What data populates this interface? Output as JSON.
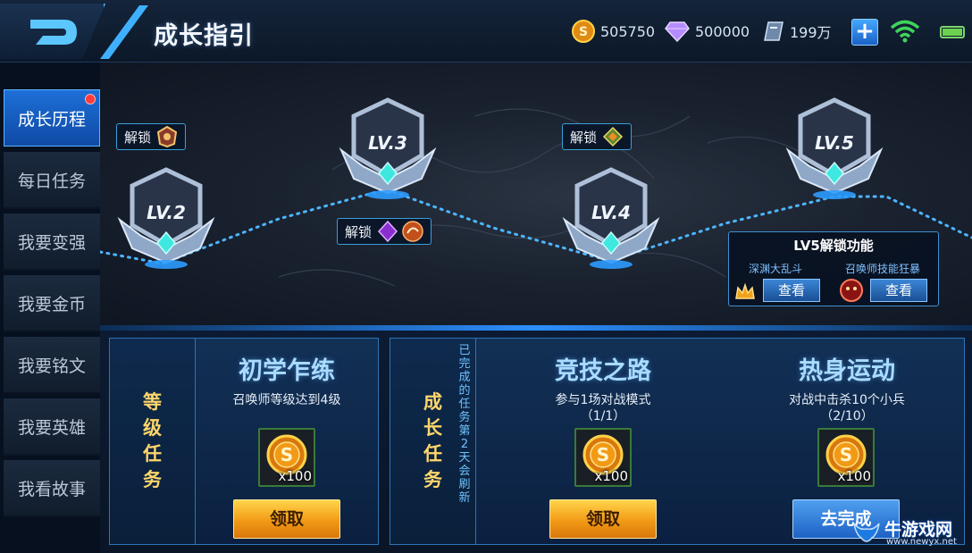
{
  "header": {
    "title": "成长指引",
    "gold": "505750",
    "gems": "500000",
    "vouchers": "199万",
    "plus_label": "+"
  },
  "sidebar": {
    "items": [
      {
        "label": "成长历程",
        "active": true
      },
      {
        "label": "每日任务"
      },
      {
        "label": "我要变强"
      },
      {
        "label": "我要金币"
      },
      {
        "label": "我要铭文"
      },
      {
        "label": "我要英雄"
      },
      {
        "label": "我看故事"
      }
    ]
  },
  "map": {
    "levels": [
      "LV.2",
      "LV.3",
      "LV.4",
      "LV.5"
    ],
    "unlock_label": "解锁",
    "lv5_panel": {
      "title": "LV5解锁功能",
      "feature_1": "深渊大乱斗",
      "feature_2": "召唤师技能狂暴",
      "view_label": "查看"
    }
  },
  "level_tasks": {
    "label_chars": [
      "等",
      "级",
      "任",
      "务"
    ],
    "task": {
      "name": "初学乍练",
      "desc": "召唤师等级达到4级",
      "reward_qty": "x100",
      "button": "领取"
    }
  },
  "growth_tasks": {
    "label_chars": [
      "成",
      "长",
      "任",
      "务"
    ],
    "note_chars": [
      "已",
      "完",
      "成",
      "的",
      "任",
      "务",
      "第",
      "2",
      "天",
      "会",
      "刷",
      "新"
    ],
    "tasks": [
      {
        "name": "竞技之路",
        "desc": "参与1场对战模式",
        "progress": "（1/1）",
        "reward_qty": "x100",
        "button": "领取"
      },
      {
        "name": "热身运动",
        "desc": "对战中击杀10个小兵",
        "progress": "（2/10）",
        "reward_qty": "x100",
        "button": "去完成"
      }
    ]
  },
  "watermark": {
    "main": "牛游戏网",
    "sub": "www.newyx.net"
  },
  "colors": {
    "accent": "#2c8fff",
    "gold_button": "#f29a16",
    "blue_button": "#1e62c4",
    "task_label": "#ffd66b"
  }
}
